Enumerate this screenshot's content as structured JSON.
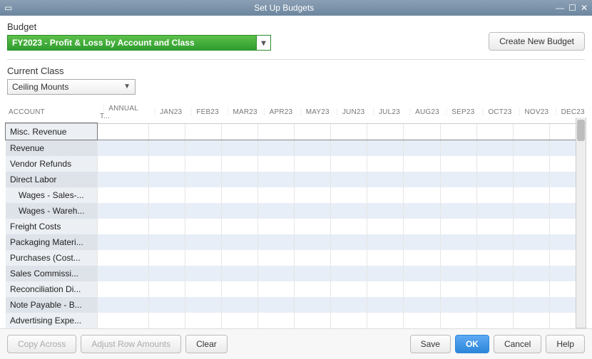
{
  "title": "Set Up Budgets",
  "budget_label": "Budget",
  "budget_selected": "FY2023 - Profit & Loss by Account and Class",
  "create_budget_label": "Create New Budget",
  "current_class_label": "Current Class",
  "current_class_selected": "Ceiling Mounts",
  "columns": [
    "ACCOUNT",
    "ANNUAL T...",
    "JAN23",
    "FEB23",
    "MAR23",
    "APR23",
    "MAY23",
    "JUN23",
    "JUL23",
    "AUG23",
    "SEP23",
    "OCT23",
    "NOV23",
    "DEC23"
  ],
  "accounts": [
    {
      "label": "Misc. Revenue",
      "indent": false,
      "selected": true
    },
    {
      "label": "Revenue",
      "indent": false
    },
    {
      "label": "Vendor Refunds",
      "indent": false
    },
    {
      "label": "Direct Labor",
      "indent": false
    },
    {
      "label": "Wages - Sales-...",
      "indent": true
    },
    {
      "label": "Wages - Wareh...",
      "indent": true
    },
    {
      "label": "Freight Costs",
      "indent": false
    },
    {
      "label": "Packaging Materi...",
      "indent": false
    },
    {
      "label": "Purchases  (Cost...",
      "indent": false
    },
    {
      "label": "Sales Commissi...",
      "indent": false
    },
    {
      "label": "Reconciliation Di...",
      "indent": false
    },
    {
      "label": "Note Payable - B...",
      "indent": false
    },
    {
      "label": "Advertising Expe...",
      "indent": false
    }
  ],
  "footer": {
    "copy_across": "Copy Across",
    "adjust_row": "Adjust Row Amounts",
    "clear": "Clear",
    "save": "Save",
    "ok": "OK",
    "cancel": "Cancel",
    "help": "Help"
  }
}
